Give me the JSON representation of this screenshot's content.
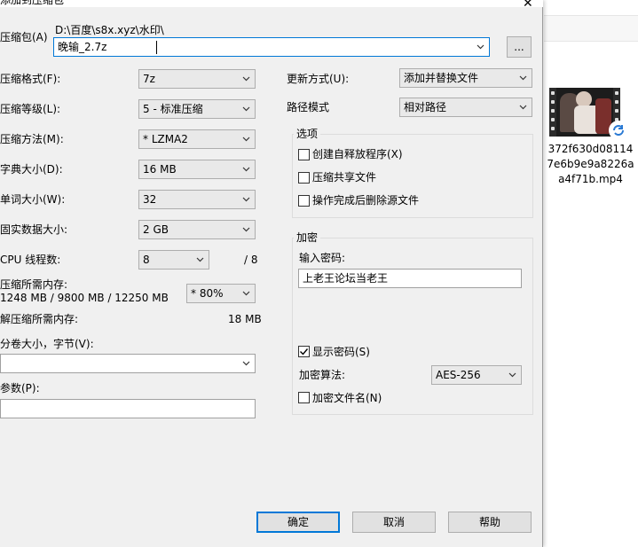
{
  "window": {
    "title": "添加到压缩包",
    "close_symbol": "✕"
  },
  "archive": {
    "label": "压缩包(A)",
    "path": "D:\\百度\\s8x.xyz\\水印\\",
    "name": "晚输_2.7z",
    "browse_label": "..."
  },
  "options": {
    "format": {
      "label": "压缩格式(F):",
      "value": "7z"
    },
    "level": {
      "label": "压缩等级(L):",
      "value": "5 - 标准压缩"
    },
    "method": {
      "label": "压缩方法(M):",
      "value": "* LZMA2"
    },
    "dict": {
      "label": "字典大小(D):",
      "value": "16 MB"
    },
    "word": {
      "label": "单词大小(W):",
      "value": "32"
    },
    "solid": {
      "label": "固实数据大小:",
      "value": "2 GB"
    },
    "threads": {
      "label": "CPU 线程数:",
      "value": "8",
      "max": "/ 8"
    },
    "mem_compress": {
      "label": "压缩所需内存:",
      "detail": "1248 MB / 9800 MB / 12250 MB",
      "percent": "* 80%"
    },
    "mem_decompress": {
      "label": "解压缩所需内存:",
      "value": "18 MB"
    },
    "volume": {
      "label": "分卷大小，字节(V):",
      "value": ""
    },
    "params": {
      "label": "参数(P):",
      "value": ""
    }
  },
  "update": {
    "label": "更新方式(U):",
    "value": "添加并替换文件"
  },
  "pathmode": {
    "label": "路径模式",
    "value": "相对路径"
  },
  "group_options": {
    "title": "选项",
    "items": [
      {
        "label": "创建自释放程序(X)",
        "checked": false
      },
      {
        "label": "压缩共享文件",
        "checked": false
      },
      {
        "label": "操作完成后删除源文件",
        "checked": false
      }
    ]
  },
  "encryption": {
    "title": "加密",
    "password_label": "输入密码:",
    "password": "上老王论坛当老王",
    "show_password_label": "显示密码(S)",
    "show_password_checked": true,
    "method_label": "加密算法:",
    "method_value": "AES-256",
    "encrypt_names_label": "加密文件名(N)",
    "encrypt_names_checked": false
  },
  "buttons": {
    "ok": "确定",
    "cancel": "取消",
    "help": "帮助"
  },
  "background_file": {
    "name_line1": "372f630d08114",
    "name_line2": "7e6b9e9a8226a",
    "name_line3": "a4f71b.mp4"
  },
  "colors": {
    "focus": "#0078d7",
    "dialog_bg": "#f0f0f0"
  }
}
